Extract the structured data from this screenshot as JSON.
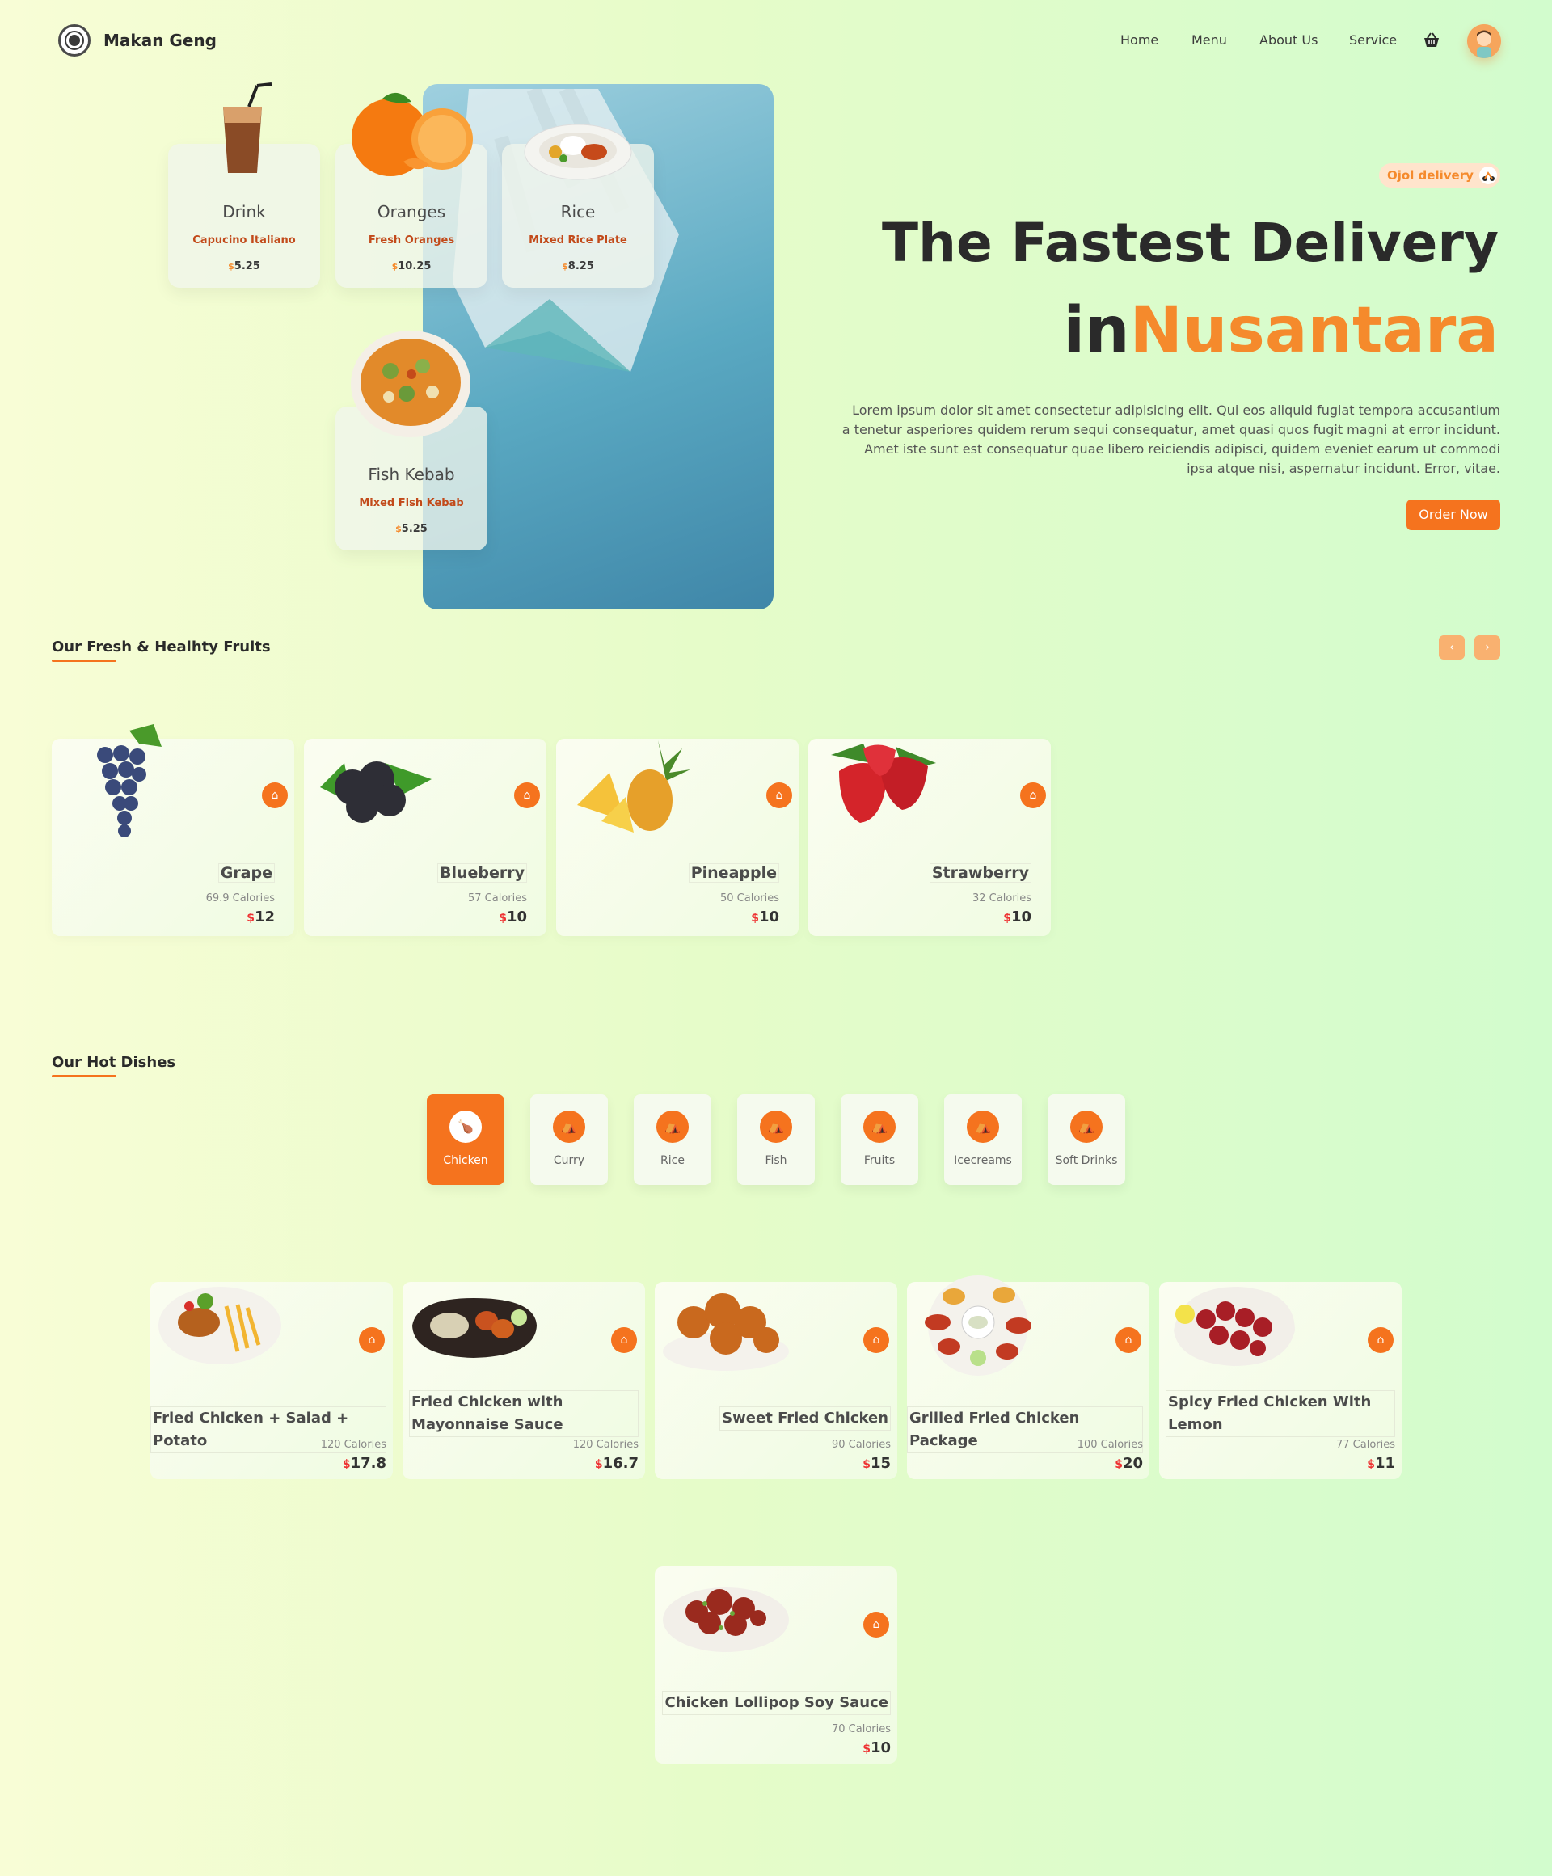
{
  "header": {
    "brand": "Makan Geng",
    "nav": [
      "Home",
      "Menu",
      "About Us",
      "Service"
    ]
  },
  "hero_cards": [
    {
      "title": "Drink",
      "subtitle": "Capucino Italiano",
      "price": "5.25"
    },
    {
      "title": "Oranges",
      "subtitle": "Fresh Oranges",
      "price": "10.25"
    },
    {
      "title": "Rice",
      "subtitle": "Mixed Rice Plate",
      "price": "8.25"
    },
    {
      "title": "Fish Kebab",
      "subtitle": "Mixed Fish Kebab",
      "price": "5.25"
    }
  ],
  "hero": {
    "badge": "Ojol delivery",
    "headline": "The Fastest Delivery",
    "headline2_prefix": "in",
    "headline2_highlight": "Nusantara",
    "lead": "Lorem ipsum dolor sit amet consectetur adipisicing elit. Qui eos aliquid fugiat tempora accusantium a tenetur asperiores quidem rerum sequi consequatur, amet quasi quos fugit magni at error incidunt. Amet iste sunt est consequatur quae libero reiciendis adipisci, quidem eveniet earum ut commodi ipsa atque nisi, aspernatur incidunt. Error, vitae.",
    "cta": "Order Now"
  },
  "fruits_section": {
    "title": "Our Fresh & Healhty Fruits",
    "prev": "‹",
    "next": "›",
    "items": [
      {
        "name": "Grape",
        "calories": "69.9 Calories",
        "price": "12"
      },
      {
        "name": "Blueberry",
        "calories": "57 Calories",
        "price": "10"
      },
      {
        "name": "Pineapple",
        "calories": "50 Calories",
        "price": "10"
      },
      {
        "name": "Strawberry",
        "calories": "32 Calories",
        "price": "10"
      }
    ]
  },
  "dishes_section": {
    "title": "Our Hot Dishes",
    "categories": [
      "Chicken",
      "Curry",
      "Rice",
      "Fish",
      "Fruits",
      "Icecreams",
      "Soft Drinks"
    ],
    "active_category": "Chicken",
    "items": [
      {
        "name": "Fried Chicken + Salad + Potato",
        "calories": "120 Calories",
        "price": "17.8"
      },
      {
        "name": "Fried Chicken with Mayonnaise Sauce",
        "calories": "120 Calories",
        "price": "16.7"
      },
      {
        "name": "Sweet Fried Chicken",
        "calories": "90 Calories",
        "price": "15"
      },
      {
        "name": "Grilled Fried Chicken Package",
        "calories": "100 Calories",
        "price": "20"
      },
      {
        "name": "Spicy Fried Chicken With Lemon",
        "calories": "77 Calories",
        "price": "11"
      },
      {
        "name": "Chicken Lollipop Soy Sauce",
        "calories": "70 Calories",
        "price": "10"
      }
    ]
  },
  "currency_symbol": "$",
  "colors": {
    "accent": "#f5731e",
    "accent_light": "#f9b170",
    "price_symbol": "#e33333"
  }
}
